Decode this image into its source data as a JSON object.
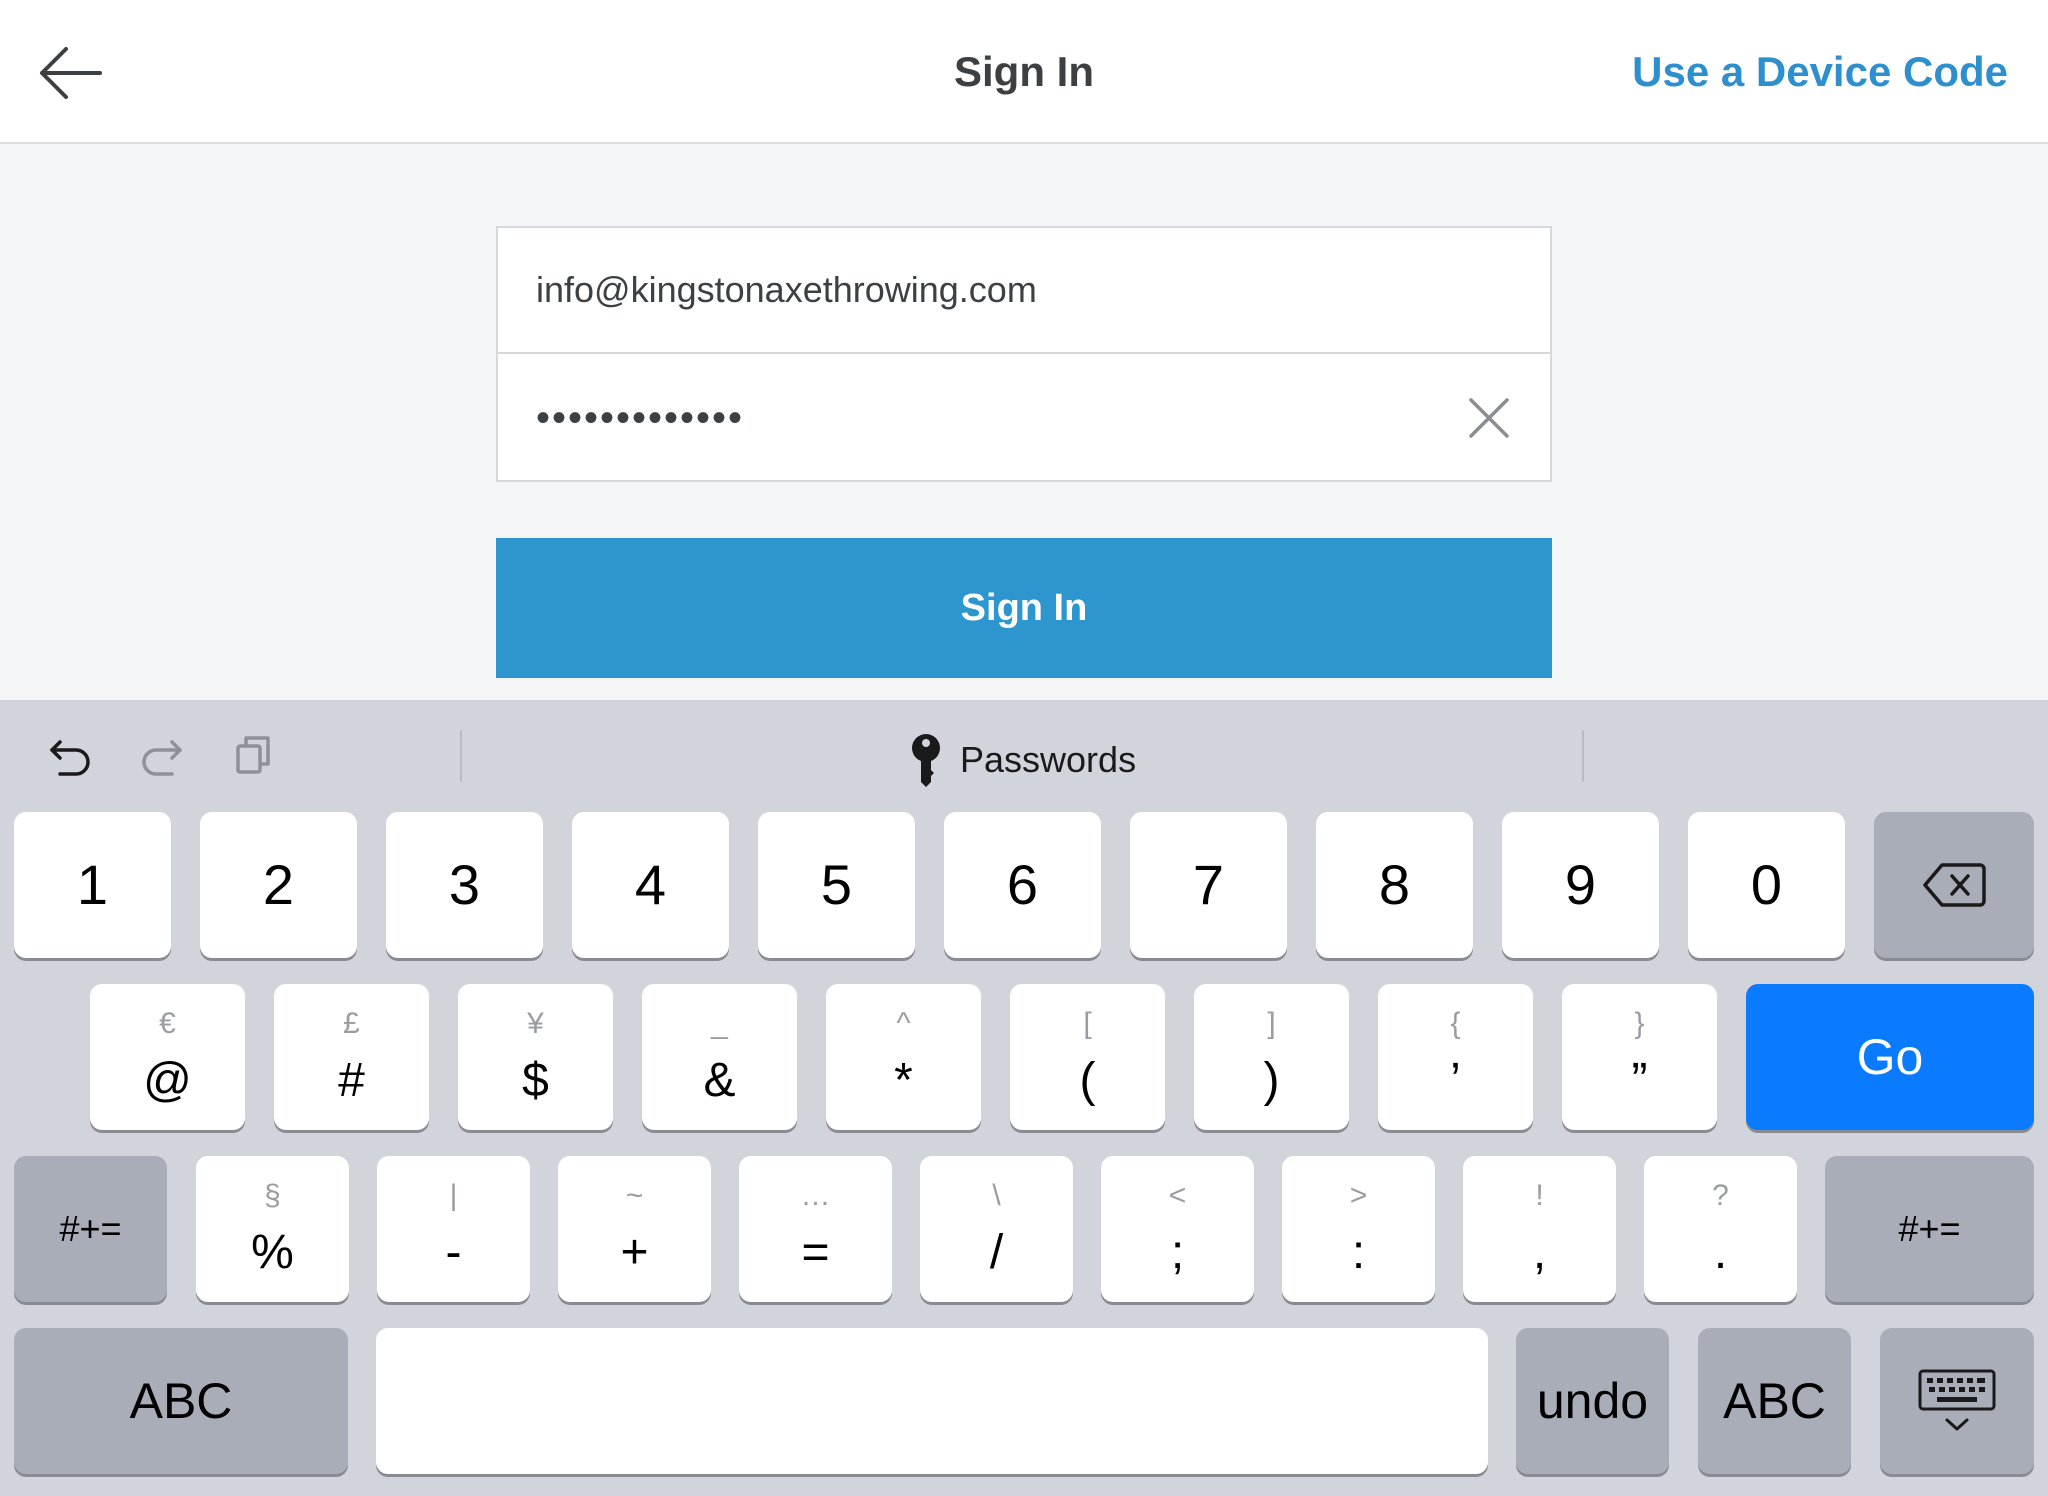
{
  "header": {
    "title": "Sign In",
    "device_code": "Use a Device Code"
  },
  "form": {
    "email_value": "info@kingstonaxethrowing.com",
    "password_value": "•••••••••••••",
    "signin_label": "Sign In"
  },
  "keyboard": {
    "passwords_label": "Passwords",
    "row1": [
      "1",
      "2",
      "3",
      "4",
      "5",
      "6",
      "7",
      "8",
      "9",
      "0"
    ],
    "row2": [
      {
        "alt": "€",
        "main": "@"
      },
      {
        "alt": "£",
        "main": "#"
      },
      {
        "alt": "¥",
        "main": "$"
      },
      {
        "alt": "_",
        "main": "&"
      },
      {
        "alt": "^",
        "main": "*"
      },
      {
        "alt": "[",
        "main": "("
      },
      {
        "alt": "]",
        "main": ")"
      },
      {
        "alt": "{",
        "main": "’"
      },
      {
        "alt": "}",
        "main": "”"
      }
    ],
    "go_label": "Go",
    "row3": [
      {
        "alt": "§",
        "main": "%"
      },
      {
        "alt": "|",
        "main": "-"
      },
      {
        "alt": "~",
        "main": "+"
      },
      {
        "alt": "…",
        "main": "="
      },
      {
        "alt": "\\",
        "main": "/"
      },
      {
        "alt": "<",
        "main": ";"
      },
      {
        "alt": ">",
        "main": ":"
      },
      {
        "alt": "!",
        "main": ","
      },
      {
        "alt": "?",
        "main": "."
      }
    ],
    "symbols_label": "#+=",
    "abc_label": "ABC",
    "undo_label": "undo"
  },
  "colors": {
    "accent": "#2d96ce",
    "go_key": "#0a7bff",
    "link": "#2e8fcf"
  }
}
